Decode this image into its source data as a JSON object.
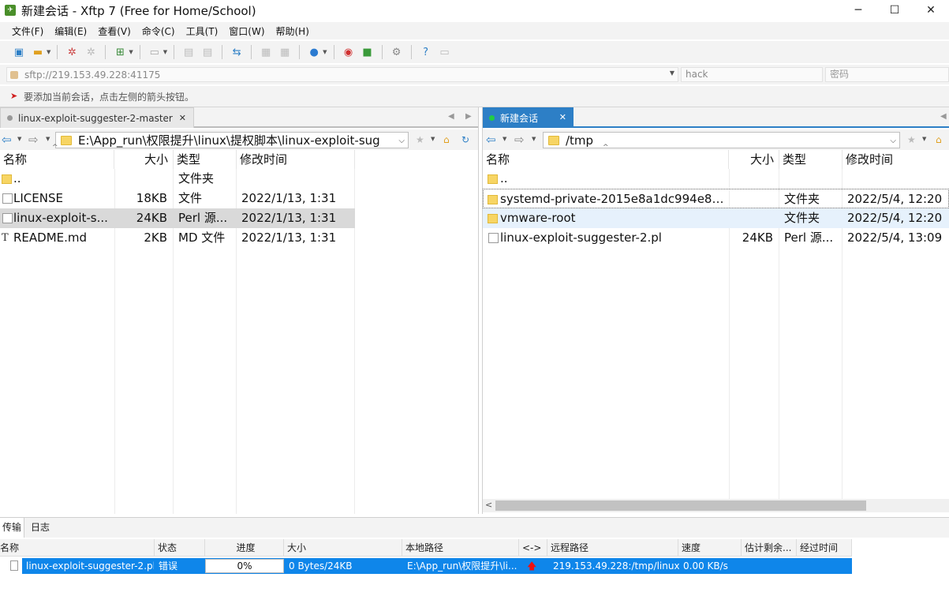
{
  "window": {
    "title": "新建会话 - Xftp 7 (Free for Home/School)",
    "app_icon": "xftp-logo-icon",
    "controls": [
      "─",
      "☐",
      "✕"
    ]
  },
  "menu": [
    "文件(F)",
    "编辑(E)",
    "查看(V)",
    "命令(C)",
    "工具(T)",
    "窗口(W)",
    "帮助(H)"
  ],
  "address": {
    "url_placeholder": "sftp://219.153.49.228:41175",
    "user_placeholder": "hack",
    "password_placeholder": "密码"
  },
  "hint": "要添加当前会话，点击左侧的箭头按钮。",
  "left_pane": {
    "tab_label": "linux-exploit-suggester-2-master",
    "path": "E:\\App_run\\权限提升\\linux\\提权脚本\\linux-exploit-sug",
    "columns": [
      "名称",
      "大小",
      "类型",
      "修改时间"
    ],
    "rows": [
      {
        "name": "..",
        "size": "",
        "type": "文件夹",
        "modified": "",
        "icon": "folder-icon"
      },
      {
        "name": "LICENSE",
        "size": "18KB",
        "type": "文件",
        "modified": "2022/1/13, 1:31",
        "icon": "file-icon"
      },
      {
        "name": "linux-exploit-s...",
        "size": "24KB",
        "type": "Perl 源...",
        "modified": "2022/1/13, 1:31",
        "icon": "file-icon"
      },
      {
        "name": "README.md",
        "size": "2KB",
        "type": "MD 文件",
        "modified": "2022/1/13, 1:31",
        "icon": "text-file-icon"
      }
    ]
  },
  "right_pane": {
    "tab_label": "新建会话",
    "status_color": "#22cc44",
    "path": "/tmp",
    "columns": [
      "名称",
      "大小",
      "类型",
      "修改时间"
    ],
    "rows": [
      {
        "name": "..",
        "size": "",
        "type": "",
        "modified": "",
        "icon": "folder-icon"
      },
      {
        "name": "systemd-private-2015e8a1dc994e8f...",
        "size": "",
        "type": "文件夹",
        "modified": "2022/5/4, 12:20",
        "icon": "folder-icon"
      },
      {
        "name": "vmware-root",
        "size": "",
        "type": "文件夹",
        "modified": "2022/5/4, 12:20",
        "icon": "folder-icon"
      },
      {
        "name": "linux-exploit-suggester-2.pl",
        "size": "24KB",
        "type": "Perl 源...",
        "modified": "2022/5/4, 13:09",
        "icon": "file-icon"
      }
    ]
  },
  "transfer": {
    "tabs": [
      "传输",
      "日志"
    ],
    "columns": [
      "名称",
      "状态",
      "进度",
      "大小",
      "本地路径",
      "<->",
      "远程路径",
      "速度",
      "估计剩余...",
      "经过时间"
    ],
    "rows": [
      {
        "name": "linux-exploit-suggester-2.pl",
        "status": "错误",
        "progress": "0%",
        "size": "0 Bytes/24KB",
        "local": "E:\\App_run\\权限提升\\li...",
        "direction": "🡅",
        "remote": "219.153.49.228:/tmp/linux...",
        "speed": "0.00 KB/s",
        "eta": "",
        "elapsed": ""
      }
    ]
  },
  "colors": {
    "accent": "#2d7fc6",
    "selection": "#0f86ea"
  }
}
